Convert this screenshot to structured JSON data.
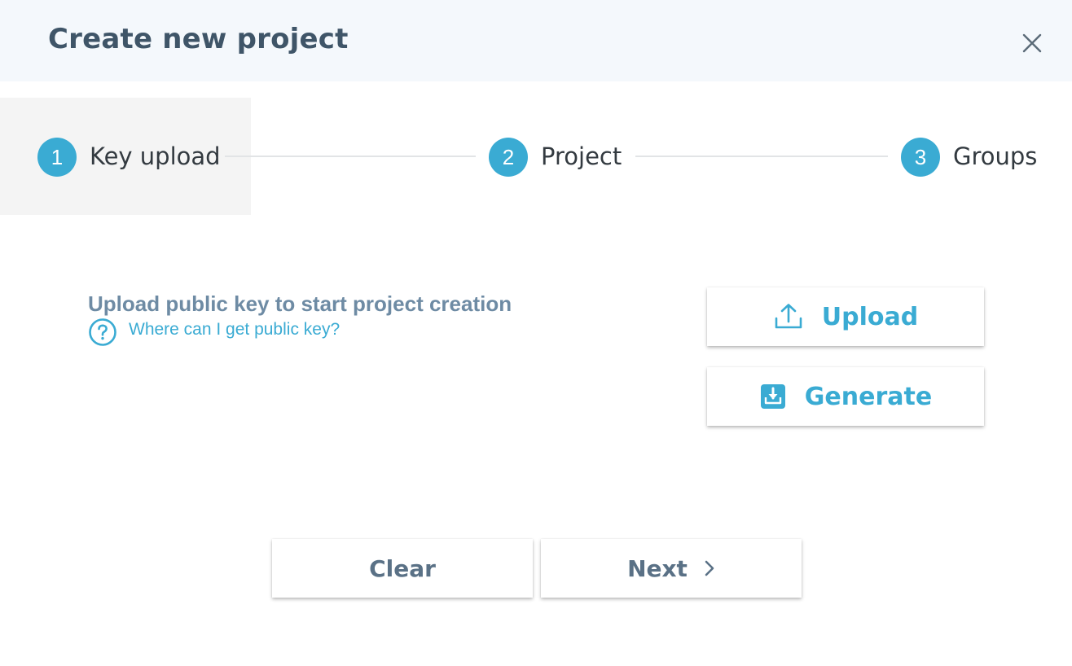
{
  "dialog": {
    "title": "Create new project",
    "close_icon": "close-icon"
  },
  "stepper": {
    "steps": [
      {
        "number": "1",
        "label": "Key upload",
        "active": true
      },
      {
        "number": "2",
        "label": "Project",
        "active": false
      },
      {
        "number": "3",
        "label": "Groups",
        "active": false
      }
    ]
  },
  "content": {
    "heading": "Upload public key to start project creation",
    "help_link": "Where can I get public key?",
    "help_icon": "question-circle-icon"
  },
  "actions": {
    "upload_label": "Upload",
    "upload_icon": "upload-icon",
    "generate_label": "Generate",
    "generate_icon": "download-box-icon"
  },
  "footer": {
    "clear_label": "Clear",
    "next_label": "Next",
    "next_icon": "chevron-right-icon"
  },
  "colors": {
    "accent": "#3aabd3",
    "header_bg": "#f4f8fc",
    "title": "#3f5568",
    "muted_heading": "#6e8ba4",
    "footer_button_text": "#5a7186"
  }
}
